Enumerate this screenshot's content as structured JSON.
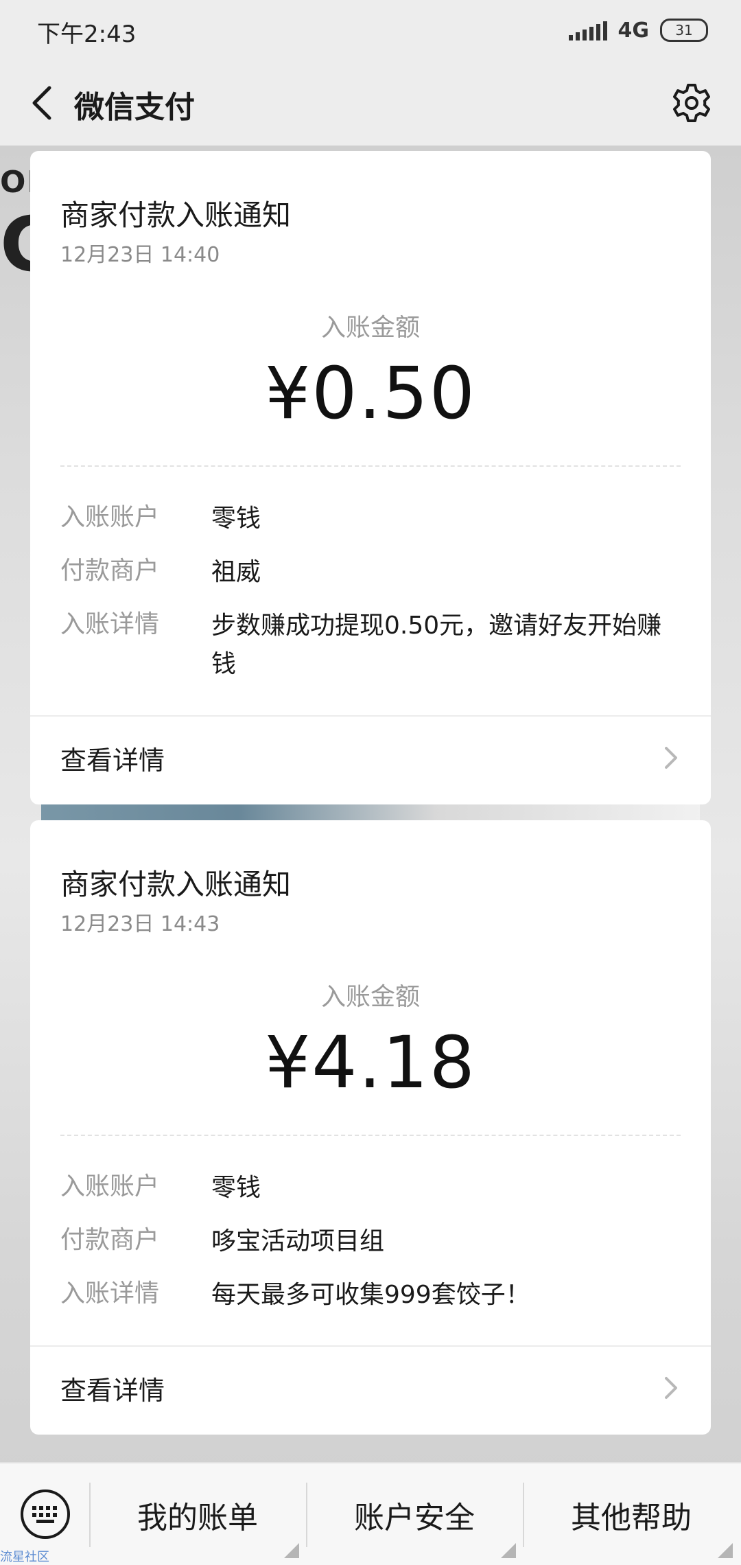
{
  "status_bar": {
    "time": "下午2:43",
    "network": "4G",
    "battery": "31"
  },
  "nav": {
    "title": "微信支付",
    "back_icon": "chevron-left-icon",
    "settings_icon": "gear-icon"
  },
  "background": {
    "text_top": "OR",
    "text_big": "C"
  },
  "messages": [
    {
      "title": "商家付款入账通知",
      "time": "12月23日  14:40",
      "amount_label": "入账金额",
      "amount": "¥0.50",
      "rows": [
        {
          "label": "入账账户",
          "value": "零钱"
        },
        {
          "label": "付款商户",
          "value": "祖威"
        },
        {
          "label": "入账详情",
          "value": "步数赚成功提现0.50元，邀请好友开始赚钱"
        }
      ],
      "link": "查看详情"
    },
    {
      "title": "商家付款入账通知",
      "time": "12月23日  14:43",
      "amount_label": "入账金额",
      "amount": "¥4.18",
      "rows": [
        {
          "label": "入账账户",
          "value": "零钱"
        },
        {
          "label": "付款商户",
          "value": "哆宝活动项目组"
        },
        {
          "label": "入账详情",
          "value": "每天最多可收集999套饺子！"
        }
      ],
      "link": "查看详情"
    }
  ],
  "bottom_menu": {
    "keyboard_icon": "keyboard-icon",
    "items": [
      "我的账单",
      "账户安全",
      "其他帮助"
    ]
  },
  "watermark": "流星社区"
}
